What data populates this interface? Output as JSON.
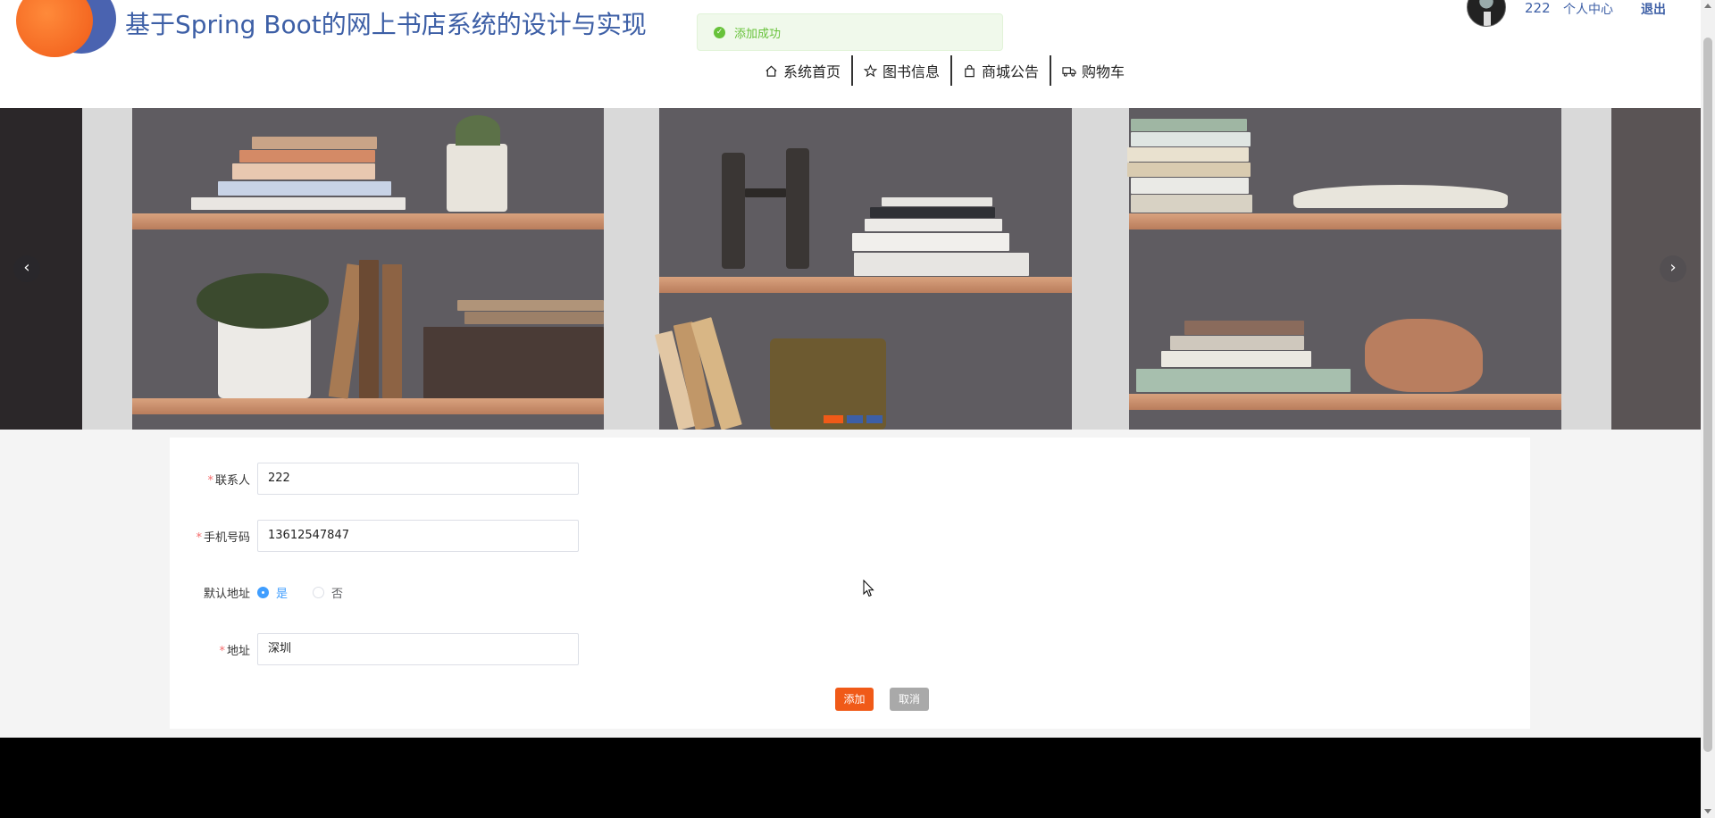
{
  "header": {
    "site_title": "基于Spring Boot的网上书店系统的设计与实现",
    "user_name": "222",
    "user_center": "个人中心",
    "logout": "退出"
  },
  "toast": {
    "message": "添加成功",
    "status_color": "#67c23a"
  },
  "nav": {
    "items": [
      {
        "label": "系统首页",
        "icon": "home-icon"
      },
      {
        "label": "图书信息",
        "icon": "star-icon"
      },
      {
        "label": "商城公告",
        "icon": "shopping-bag-icon"
      },
      {
        "label": "购物车",
        "icon": "truck-icon"
      }
    ]
  },
  "carousel": {
    "prev": "‹",
    "next": "›",
    "slide_count": 3,
    "active_index": 0
  },
  "form": {
    "contact": {
      "label": "联系人",
      "value": "222",
      "required": true
    },
    "phone": {
      "label": "手机号码",
      "value": "13612547847",
      "required": true
    },
    "default_address": {
      "label": "默认地址",
      "options": [
        {
          "label": "是",
          "checked": true
        },
        {
          "label": "否",
          "checked": false
        }
      ]
    },
    "address": {
      "label": "地址",
      "value": "深圳",
      "required": true
    },
    "add_label": "添加",
    "cancel_label": "取消"
  },
  "colors": {
    "accent": "#f05a18",
    "brand": "#3d5fa6",
    "radio_checked": "#409eff"
  }
}
